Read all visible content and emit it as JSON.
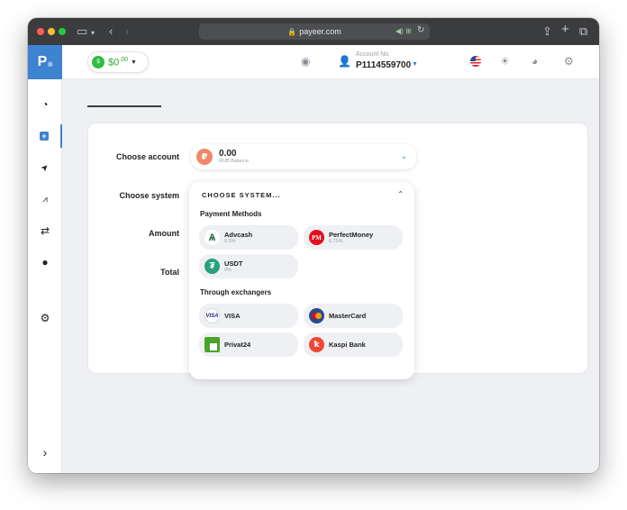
{
  "browser": {
    "url": "payeer.com"
  },
  "sidebar": {
    "logo": "P",
    "logo_sub": "®",
    "items": [
      {
        "icon": "gauge-icon",
        "glyph": "◔"
      },
      {
        "icon": "deposit-icon",
        "glyph": "+"
      },
      {
        "icon": "send-icon",
        "glyph": "➤"
      },
      {
        "icon": "chart-icon",
        "glyph": "📈"
      },
      {
        "icon": "exchange-icon",
        "glyph": "⇄"
      },
      {
        "icon": "history-icon",
        "glyph": "●"
      },
      {
        "icon": "settings-gears-icon",
        "glyph": "⚙"
      },
      {
        "icon": "expand-icon",
        "glyph": "›"
      }
    ]
  },
  "header": {
    "balance_main": "$0",
    "balance_cents": ".00",
    "account_label": "Account No.",
    "account_number": "P1114559700"
  },
  "form": {
    "choose_account_label": "Choose account",
    "choose_system_label": "Choose system",
    "amount_label": "Amount",
    "total_label": "Total",
    "account": {
      "currency_symbol": "₽",
      "amount": "0.00",
      "subtitle": "RUB Balance"
    }
  },
  "system_dropdown": {
    "placeholder": "CHOOSE SYSTEM...",
    "payment_methods_title": "Payment Methods",
    "payment_methods": [
      {
        "name": "Advcash",
        "fee": "0.5%",
        "icon": "advcash-icon",
        "color": "#ffffff"
      },
      {
        "name": "PerfectMoney",
        "fee": "6.75%",
        "icon": "perfectmoney-icon",
        "color": "#e3101b"
      },
      {
        "name": "USDT",
        "fee": "0%",
        "icon": "usdt-icon",
        "color": "#26a17b"
      }
    ],
    "exchangers_title": "Through exchangers",
    "exchangers": [
      {
        "name": "VISA",
        "icon": "visa-icon"
      },
      {
        "name": "MasterCard",
        "icon": "mastercard-icon"
      },
      {
        "name": "Privat24",
        "icon": "privat24-icon"
      },
      {
        "name": "Kaspi Bank",
        "icon": "kaspi-icon"
      }
    ]
  },
  "colors": {
    "accent": "#3d83cf",
    "balance_green": "#27a833"
  }
}
